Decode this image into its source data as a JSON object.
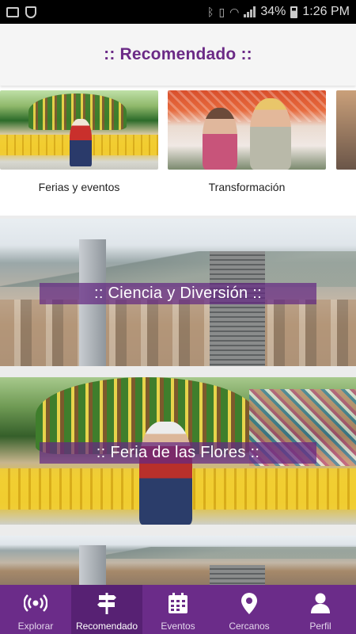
{
  "status_bar": {
    "battery": "34%",
    "time": "1:26 PM"
  },
  "header": {
    "title": ":: Recomendado ::"
  },
  "carousel": [
    {
      "caption": "Ferias y eventos"
    },
    {
      "caption": "Transformación"
    }
  ],
  "cards": [
    {
      "title": ":: Ciencia y Diversión ::"
    },
    {
      "title": ":: Feria de las Flores ::"
    }
  ],
  "bottom_nav": [
    {
      "label": "Explorar",
      "icon": "broadcast-icon"
    },
    {
      "label": "Recomendado",
      "icon": "signpost-icon",
      "active": true
    },
    {
      "label": "Eventos",
      "icon": "calendar-icon"
    },
    {
      "label": "Cercanos",
      "icon": "map-pin-icon"
    },
    {
      "label": "Perfil",
      "icon": "person-icon"
    }
  ],
  "colors": {
    "brand_purple": "#6b2c89",
    "title_purple": "#6b2a86",
    "active_tab": "#572173"
  }
}
